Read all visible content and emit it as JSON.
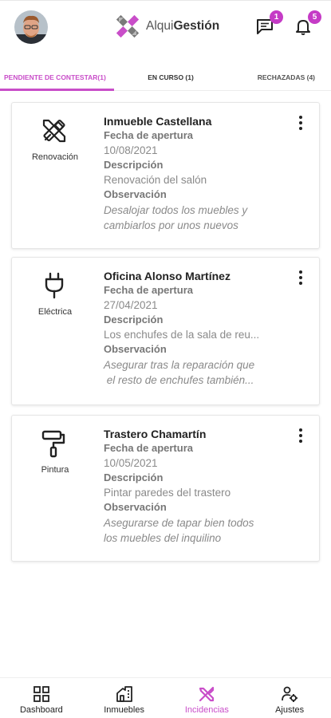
{
  "header": {
    "logo_part1": "Alqui",
    "logo_part2": "Gestión",
    "messages_badge": "1",
    "notifications_badge": "5"
  },
  "tabs": [
    {
      "label": "PENDIENTE DE CONTESTAR(1)"
    },
    {
      "label": "EN CURSO (1)"
    },
    {
      "label": "RECHAZADAS (4)"
    }
  ],
  "incidents": [
    {
      "category": "Renovación",
      "icon": "tools-icon",
      "title": "Inmueble Castellana",
      "date_label": "Fecha de apertura",
      "date": "10/08/2021",
      "desc_label": "Descripción",
      "description": "Renovación del salón",
      "obs_label": "Observación",
      "obs_line1": "Desalojar todos los muebles y",
      "obs_line2": "cambiarlos por unos nuevos"
    },
    {
      "category": "Eléctrica",
      "icon": "plug-icon",
      "title": "Oficina Alonso Martínez",
      "date_label": "Fecha de apertura",
      "date": "27/04/2021",
      "desc_label": "Descripción",
      "description": "Los enchufes de la sala de reu...",
      "obs_label": "Observación",
      "obs_line1": "Asegurar tras la reparación que",
      "obs_line2": " el resto de enchufes también..."
    },
    {
      "category": "Pintura",
      "icon": "paint-roller-icon",
      "title": "Trastero Chamartín",
      "date_label": "Fecha de apertura",
      "date": "10/05/2021",
      "desc_label": "Descripción",
      "description": "Pintar paredes del trastero",
      "obs_label": "Observación",
      "obs_line1": "Asegurarse de tapar bien todos",
      "obs_line2": "los muebles del inquilino"
    }
  ],
  "nav": [
    {
      "label": "Dashboard",
      "icon": "dashboard-icon"
    },
    {
      "label": "Inmuebles",
      "icon": "building-icon"
    },
    {
      "label": "Incidencias",
      "icon": "tools-icon"
    },
    {
      "label": "Ajustes",
      "icon": "user-settings-icon"
    }
  ],
  "colors": {
    "accent": "#c94ec9",
    "badge": "#c53bc6"
  }
}
